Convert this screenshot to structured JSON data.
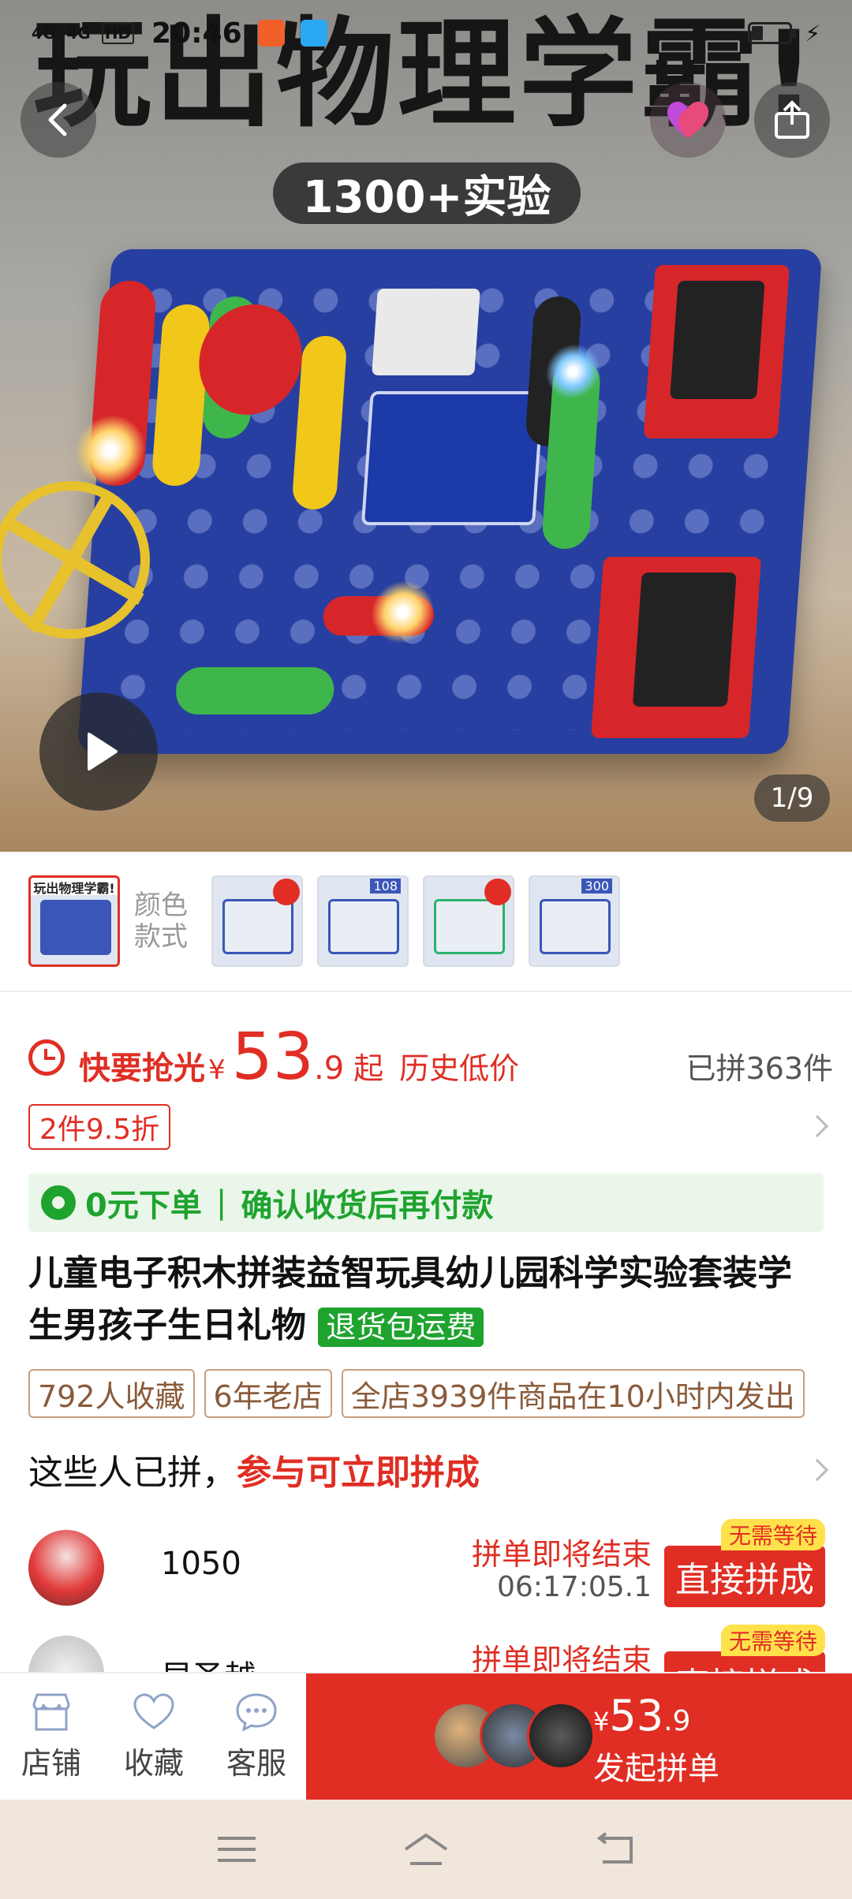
{
  "status_bar": {
    "network_1": "4G",
    "network_2": "4G",
    "hd": "HD",
    "time": "20:46",
    "battery_level": 0.3
  },
  "hero": {
    "headline": "玩出物理学霸!",
    "badge": "1300+实验",
    "pager": "1/9",
    "icons": {
      "back": "chevron-left-icon",
      "favorite": "heart-icon",
      "share": "share-icon",
      "play": "play-icon"
    }
  },
  "thumbnails": {
    "selected_caption": "玩出物理学霸!",
    "color_label": "颜色\n款式",
    "items_count_labels": [
      "108",
      "300"
    ]
  },
  "price": {
    "hurry_label": "快要抢光",
    "currency": "¥",
    "integer": "53",
    "decimal": ".9",
    "from": "起",
    "low_label": "历史低价",
    "sold": "已拼363件"
  },
  "discount": "2件9.5折",
  "zero_order": {
    "left": "0元下单",
    "right": "确认收货后再付款"
  },
  "product": {
    "title": "儿童电子积木拼装益智玩具幼儿园科学实验套装学生男孩子生日礼物",
    "tag": "退货包运费"
  },
  "chips": [
    "792人收藏",
    "6年老店",
    "全店3939件商品在10小时内发出"
  ],
  "group": {
    "head_left": "这些人已拼，",
    "head_right": "参与可立即拼成",
    "rows": [
      {
        "name": "1050",
        "status": "拼单即将结束",
        "countdown": "06:17:05.1",
        "button": "直接拼成",
        "badge": "无需等待"
      },
      {
        "name": "早圣越",
        "status": "拼单即将结束",
        "countdown": "",
        "button": "直接拼成",
        "badge": "无需等待"
      }
    ]
  },
  "bottom_bar": {
    "shop": "店铺",
    "favorite": "收藏",
    "service": "客服",
    "cta_currency": "¥",
    "cta_integer": "53",
    "cta_decimal": ".9",
    "cta_label": "发起拼单"
  },
  "colors": {
    "accent": "#e02e24",
    "green": "#1fa32f",
    "chip_border": "#c99f7c",
    "sysnav_bg": "#f1e6db"
  }
}
